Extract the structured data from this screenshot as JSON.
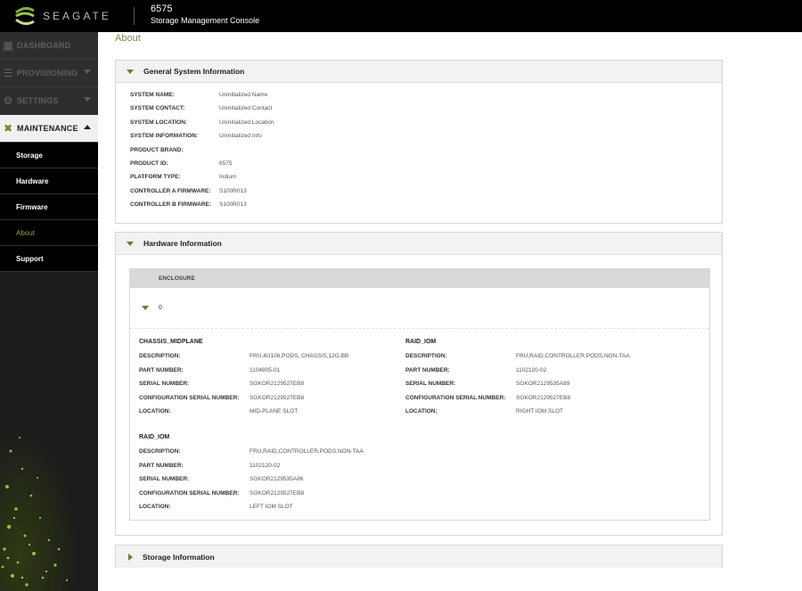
{
  "brand": {
    "name": "SEAGATE"
  },
  "header": {
    "system_name": "6575",
    "console_name": "Storage Management Console"
  },
  "sidebar": {
    "top_items": [
      {
        "label": "DASHBOARD",
        "icon": "dashboard-icon"
      },
      {
        "label": "PROVISIONING",
        "icon": "provisioning-icon"
      },
      {
        "label": "SETTINGS",
        "icon": "gear-icon"
      },
      {
        "label": "MAINTENANCE",
        "icon": "wrench-icon"
      }
    ],
    "sub_items": [
      {
        "label": "Storage"
      },
      {
        "label": "Hardware"
      },
      {
        "label": "Firmware"
      },
      {
        "label": "About"
      },
      {
        "label": "Support"
      }
    ]
  },
  "page": {
    "title": "About"
  },
  "general": {
    "title": "General System Information",
    "rows": [
      {
        "key": "SYSTEM NAME:",
        "value": "Uninitialized Name"
      },
      {
        "key": "SYSTEM CONTACT:",
        "value": "Uninitialized Contact"
      },
      {
        "key": "SYSTEM LOCATION:",
        "value": "Uninitialized Location"
      },
      {
        "key": "SYSTEM INFORMATION:",
        "value": "Uninitialized Info"
      },
      {
        "key": "PRODUCT BRAND:",
        "value": ""
      },
      {
        "key": "PRODUCT ID:",
        "value": "6575"
      },
      {
        "key": "PLATFORM TYPE:",
        "value": "Indium"
      },
      {
        "key": "CONTROLLER A FIRMWARE:",
        "value": "S100R013"
      },
      {
        "key": "CONTROLLER B FIRMWARE:",
        "value": "S100R013"
      }
    ]
  },
  "hardware": {
    "title": "Hardware Information",
    "enclosure_header": "ENCLOSURE",
    "enclosure_id": "0",
    "labels": {
      "description": "DESCRIPTION:",
      "part_number": "PART NUMBER:",
      "serial_number": "SERIAL NUMBER:",
      "config_serial": "CONFIGURATION SERIAL NUMBER:",
      "location": "LOCATION:"
    },
    "components": [
      {
        "name": "CHASSIS_MIDPLANE",
        "description": "FRU,4U106,PODS, CHASSIS,12G,BB",
        "part_number": "1104805-01",
        "serial_number": "SGKOR2129527EB8",
        "config_serial": "SGKOR2129527EB8",
        "location": "MID-PLANE SLOT"
      },
      {
        "name": "RAID_IOM",
        "description": "FRU,RAID,CONTROLLER,PODS,NON-TAA",
        "part_number": "1102120-02",
        "serial_number": "SGKOR2129535A89",
        "config_serial": "SGKOR2129527EB8",
        "location": "RIGHT IOM SLOT"
      },
      {
        "name": "RAID_IOM",
        "description": "FRU,RAID,CONTROLLER,PODS,NON-TAA",
        "part_number": "1102120-02",
        "serial_number": "SGKOR2129535A86",
        "config_serial": "SGKOR2129527EB8",
        "location": "LEFT IOM SLOT"
      }
    ]
  },
  "storage": {
    "title": "Storage Information"
  }
}
